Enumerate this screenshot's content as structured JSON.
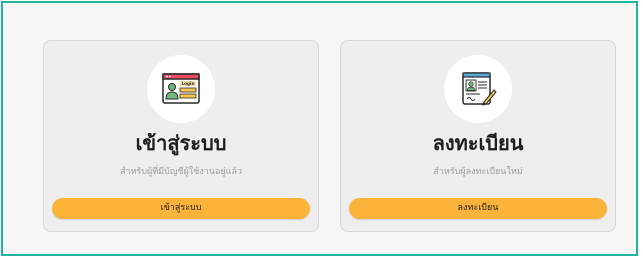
{
  "cards": {
    "login": {
      "title": "เข้าสู่ระบบ",
      "description": "สำหรับผู้ที่มีบัญชีผู้ใช้งานอยู่แล้ว",
      "button_label": "เข้าสู่ระบบ",
      "icon_text": "Login",
      "icon": "login-screen-icon"
    },
    "register": {
      "title": "ลงทะเบียน",
      "description": "สำหรับผู้ลงทะเบียนใหม่",
      "button_label": "ลงทะเบียน",
      "icon": "register-form-icon"
    }
  },
  "colors": {
    "frame_border": "#1fb5a3",
    "button": "#fbb33a",
    "card_bg": "#eeeeee"
  }
}
